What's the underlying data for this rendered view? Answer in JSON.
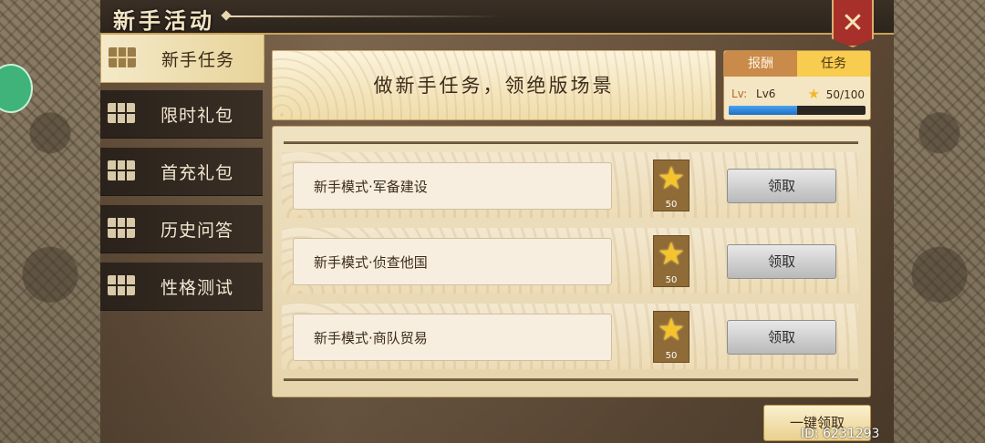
{
  "window": {
    "title": "新手活动",
    "close_icon": "close-x-icon"
  },
  "tabs": [
    {
      "label": "新手任务",
      "active": true
    },
    {
      "label": "限时礼包",
      "active": false
    },
    {
      "label": "首充礼包",
      "active": false
    },
    {
      "label": "历史问答",
      "active": false
    },
    {
      "label": "性格测试",
      "active": false
    }
  ],
  "banner": {
    "text": "做新手任务，领绝版场景"
  },
  "progress": {
    "tab_reward": "报酬",
    "tab_task": "任务",
    "active_tab": "任务",
    "level_label": "Lv:",
    "level_value": "Lv6",
    "stars_text": "50/100",
    "fraction": 0.5
  },
  "tasks": [
    {
      "name": "新手模式·军备建设",
      "reward": "50",
      "button": "领取"
    },
    {
      "name": "新手模式·侦查他国",
      "reward": "50",
      "button": "领取"
    },
    {
      "name": "新手模式·商队贸易",
      "reward": "50",
      "button": "领取"
    }
  ],
  "claim_all": "一键领取",
  "footer_id": "ID: 6231293",
  "colors": {
    "accent_gold": "#f7cc4f",
    "progress_blue": "#1e6fc4",
    "close_red": "#a8302a"
  }
}
